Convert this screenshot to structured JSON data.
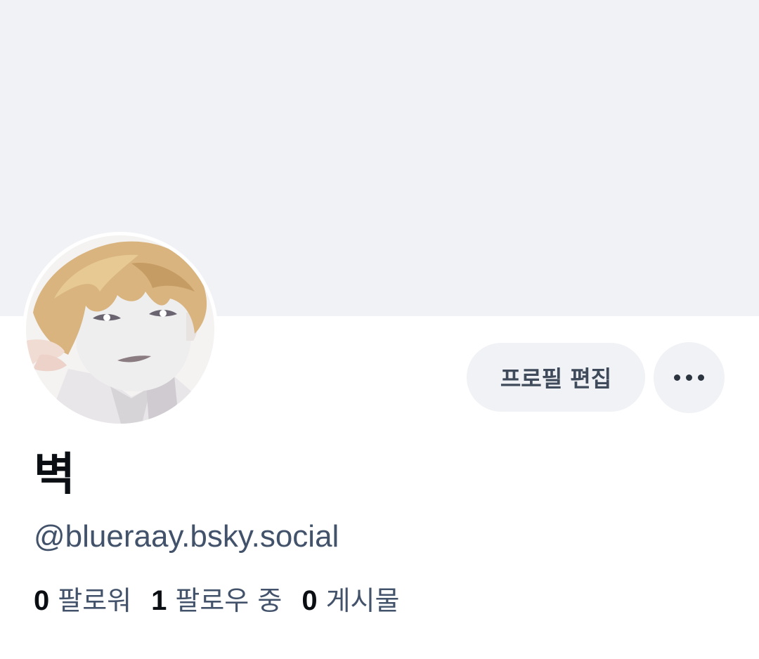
{
  "profile": {
    "display_name": "벽",
    "handle": "@blueraay.bsky.social"
  },
  "actions": {
    "edit_profile_label": "프로필 편집",
    "more_icon": "ellipsis-icon"
  },
  "stats": {
    "followers": {
      "count": "0",
      "label": "팔로워"
    },
    "following": {
      "count": "1",
      "label": "팔로우 중"
    },
    "posts": {
      "count": "0",
      "label": "게시물"
    }
  },
  "colors": {
    "banner": "#f0f2f5",
    "button_bg": "#f0f2f5",
    "primary_text": "#0b0f14",
    "secondary_text": "#42526a"
  }
}
